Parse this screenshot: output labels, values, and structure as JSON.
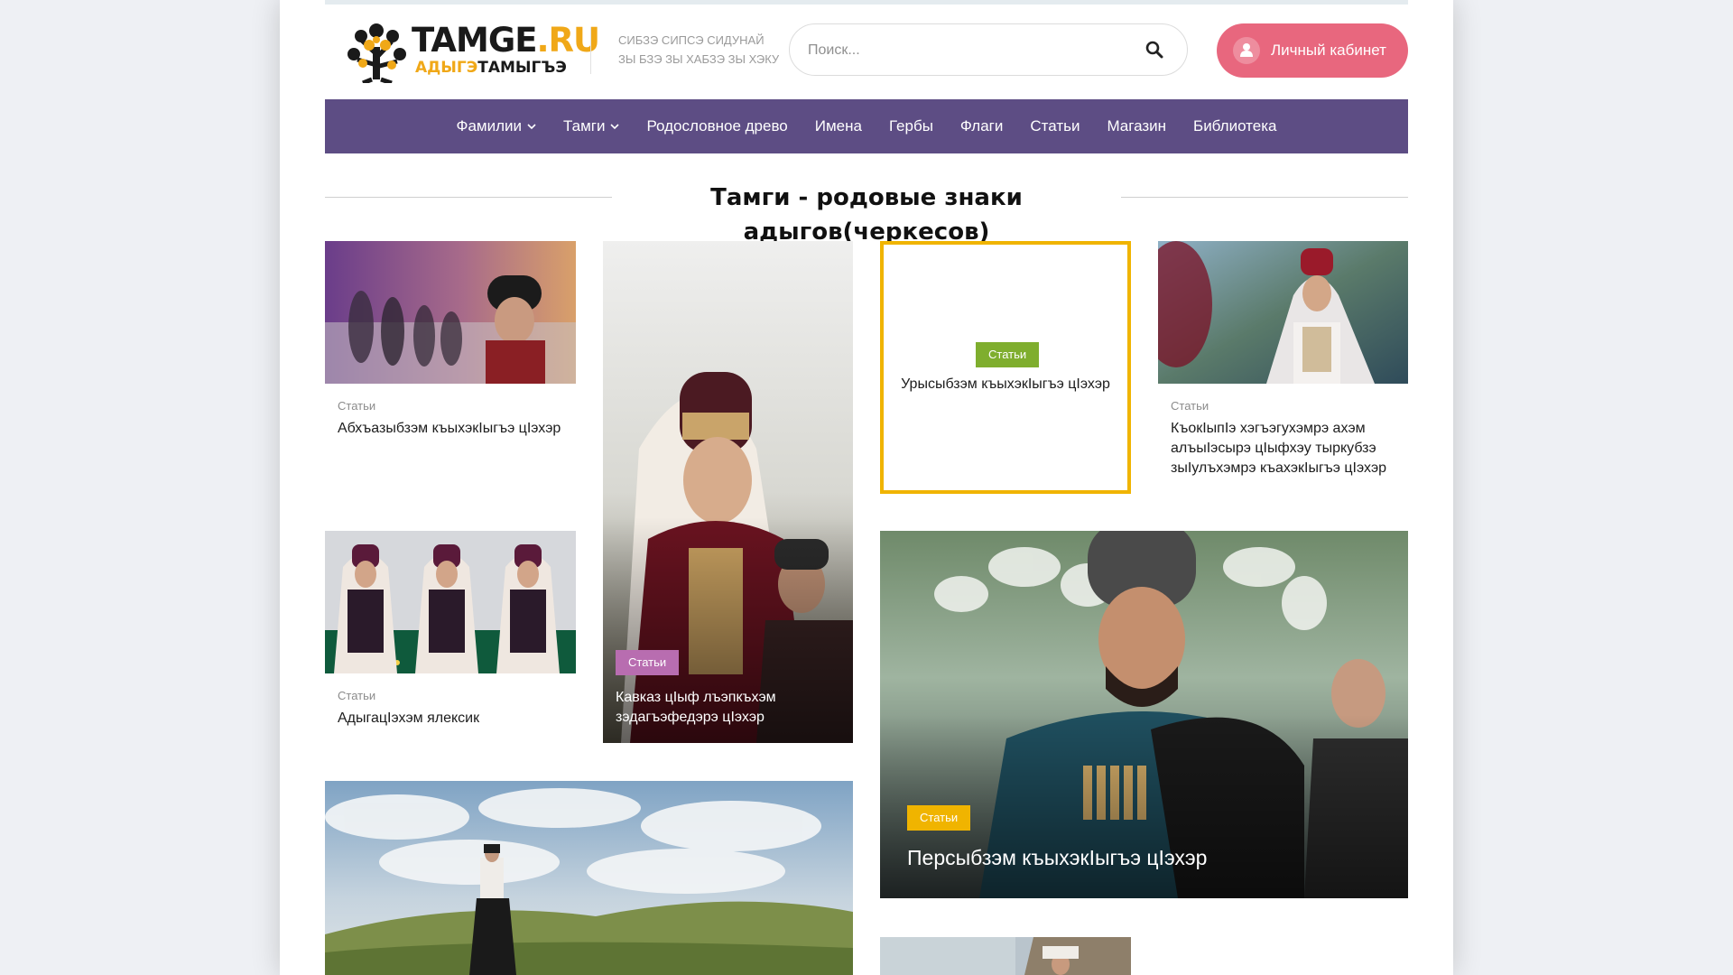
{
  "header": {
    "logo_main": "TAMGE",
    "logo_tld": ".RU",
    "logo_sub_a": "АДЫГЭ",
    "logo_sub_b": "ТАМЫГЪЭ",
    "tagline_line1": "СИБЗЭ СИПСЭ СИДУНАЙ",
    "tagline_line2": "ЗЫ БЗЭ ЗЫ ХАБЗЭ ЗЫ ХЭКУ",
    "search_placeholder": "Поиск...",
    "cabinet_label": "Личный кабинет"
  },
  "colors": {
    "nav_bg": "#5d4d84",
    "cabinet_btn": "#e8677e",
    "logo_accent": "#f0a818",
    "badge_green": "#7fae2e",
    "badge_pink": "#b86db0",
    "badge_yellow": "#f0b400",
    "card_border_yellow": "#f0b400"
  },
  "nav": {
    "items": [
      {
        "label": "Фамилии",
        "dropdown": true
      },
      {
        "label": "Тамги",
        "dropdown": true
      },
      {
        "label": "Родословное древо",
        "dropdown": false
      },
      {
        "label": "Имена",
        "dropdown": false
      },
      {
        "label": "Гербы",
        "dropdown": false
      },
      {
        "label": "Флаги",
        "dropdown": false
      },
      {
        "label": "Статьи",
        "dropdown": false
      },
      {
        "label": "Магазин",
        "dropdown": false
      },
      {
        "label": "Библиотека",
        "dropdown": false
      }
    ]
  },
  "section": {
    "title": "Тамги - родовые знаки адыгов(черкесов)"
  },
  "cards": [
    {
      "category": "Статьи",
      "title": "Абхъазыбзэм къыхэкIыгъэ цIэхэр"
    },
    {
      "category": "Статьи",
      "title": "Кавказ цIыф лъэпкъхэм зэдагъэфедэрэ цIэхэр"
    },
    {
      "category": "Статьи",
      "title": "Урысыбзэм къыхэкIыгъэ цIэхэр"
    },
    {
      "category": "Статьи",
      "title": "КъокIыпIэ хэгъэгухэмрэ ахэм алъыIэсырэ цIыфхэу тыркубзэ зыIулъхэмрэ къахэкIыгъэ цIэхэр"
    },
    {
      "category": "Статьи",
      "title": "АдыгацIэхэм ялексик"
    },
    {
      "category": "Статьи",
      "title": "Персыбзэм къыхэкIыгъэ цIэхэр"
    }
  ]
}
